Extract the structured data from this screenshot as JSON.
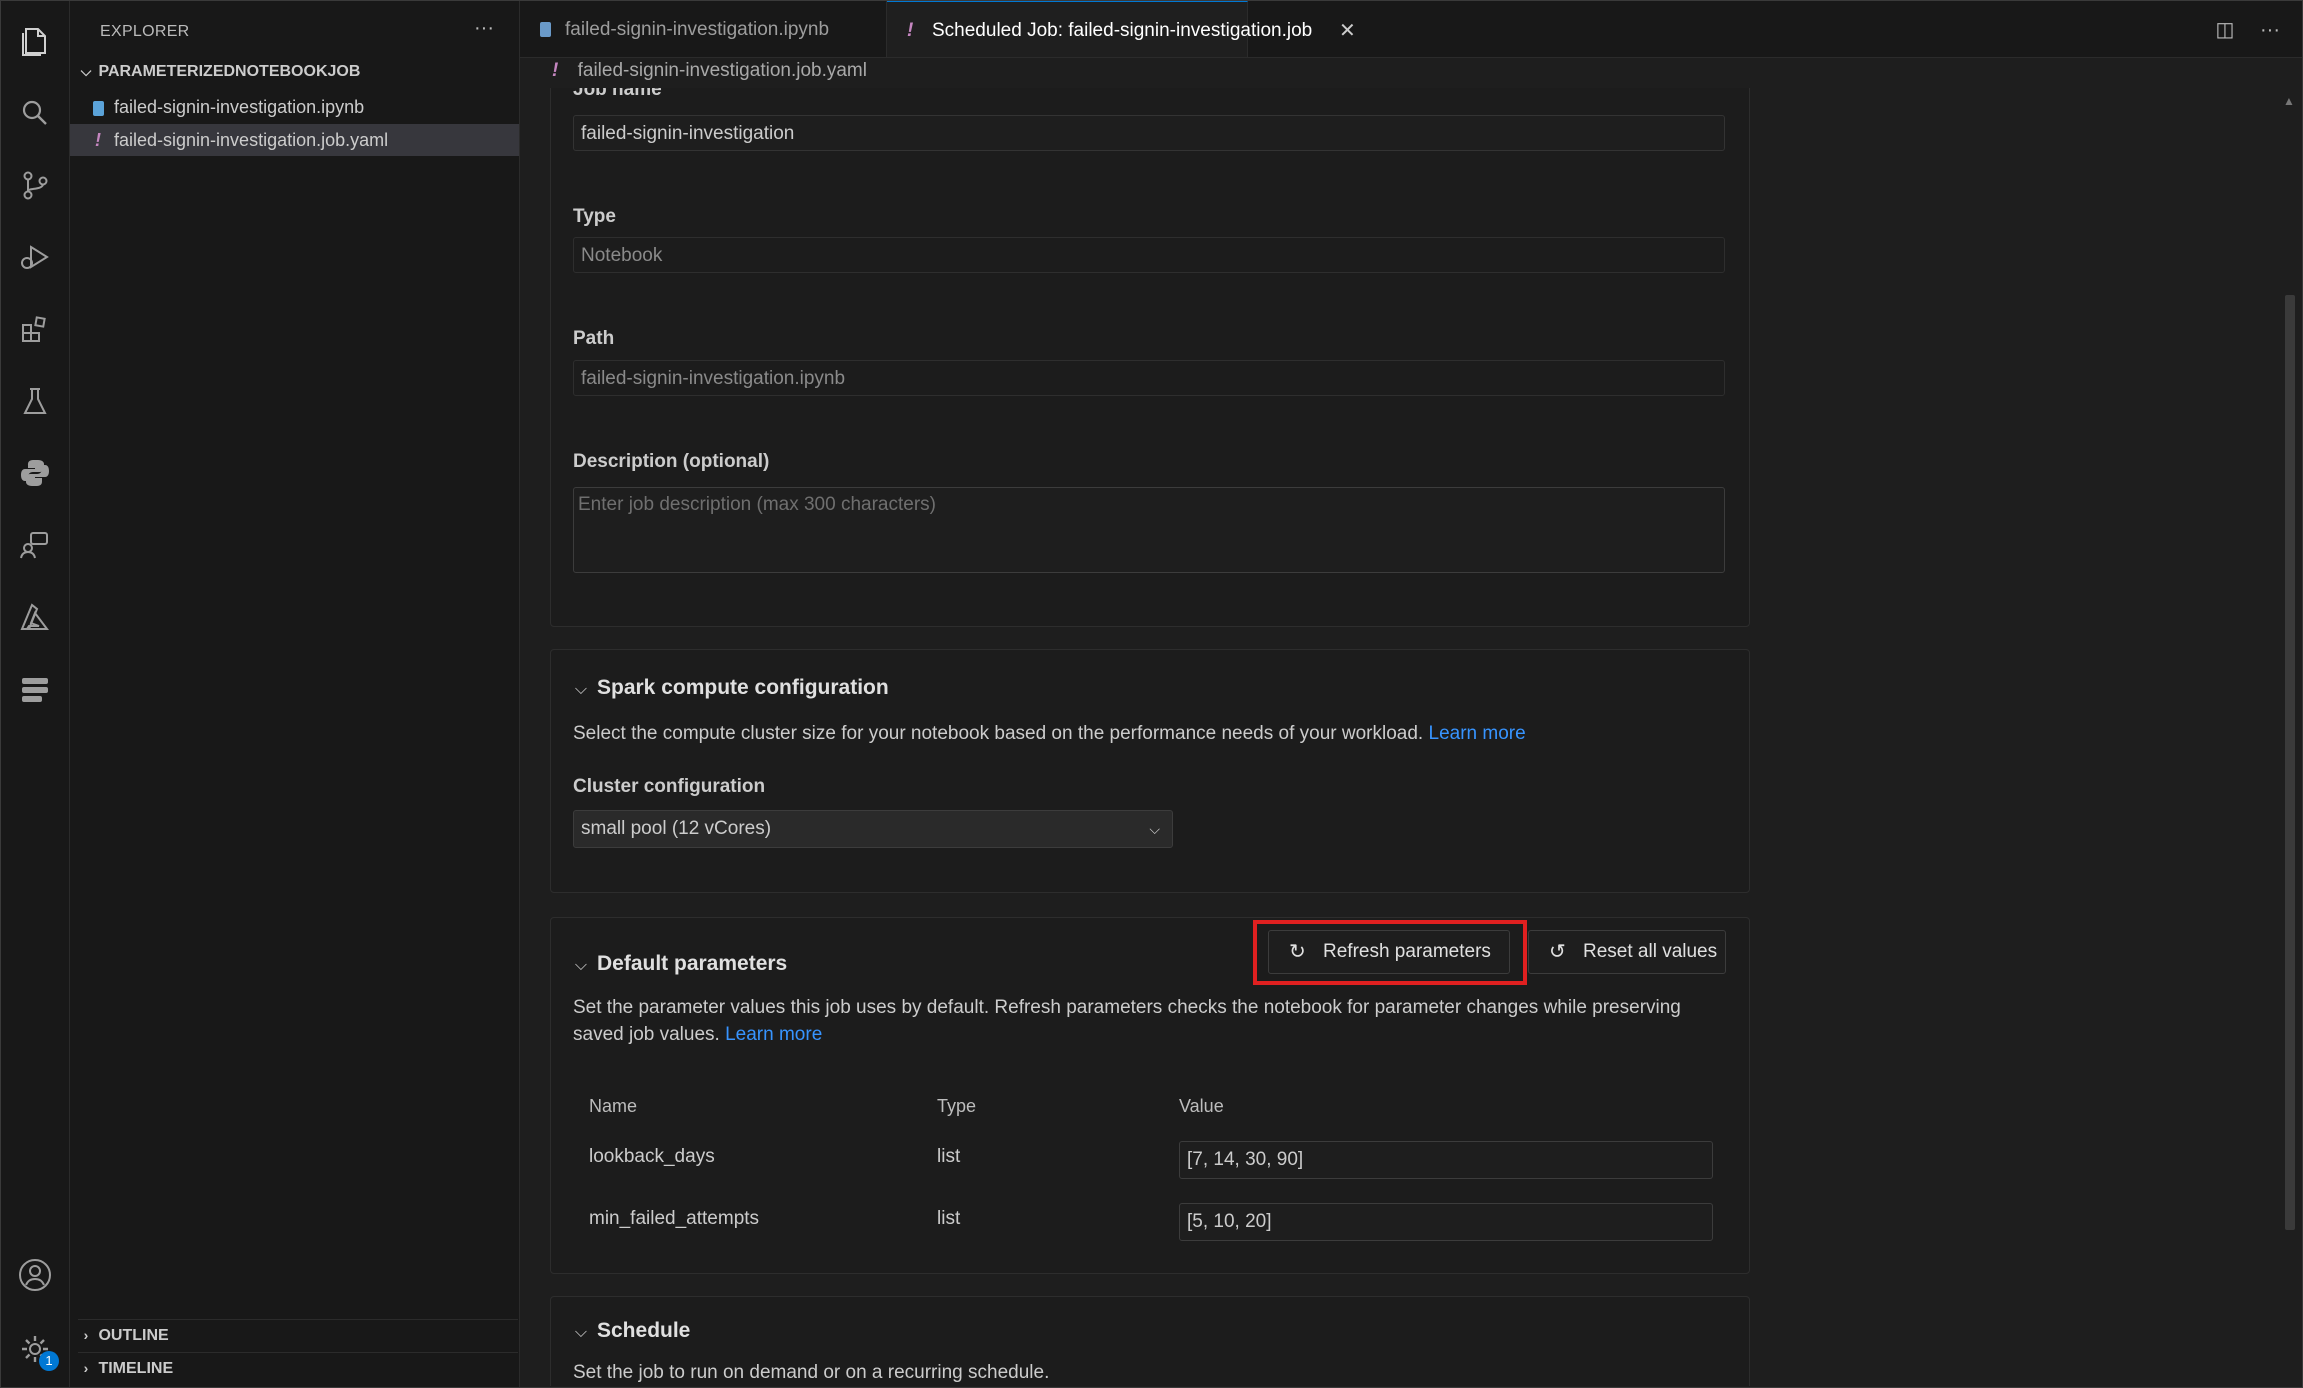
{
  "sidebar": {
    "title": "EXPLORER",
    "more_glyph": "···",
    "folder": "PARAMETERIZEDNOTEBOOKJOB",
    "files": [
      {
        "name": "failed-signin-investigation.ipynb",
        "icon": "notebook-file-icon"
      },
      {
        "name": "failed-signin-investigation.job.yaml",
        "icon": "yaml-file-icon",
        "glyph": "!"
      }
    ],
    "outline": "OUTLINE",
    "timeline": "TIMELINE"
  },
  "activity": {
    "settings_badge": "1",
    "icons": [
      "explorer-icon",
      "search-icon",
      "source-control-icon",
      "run-debug-icon",
      "extensions-icon",
      "testing-icon",
      "python-icon",
      "remote-chat-icon",
      "azure-icon",
      "data-icon",
      "account-icon",
      "settings-gear-icon"
    ]
  },
  "tabs": [
    {
      "label": "failed-signin-investigation.ipynb",
      "active": false
    },
    {
      "label": "Scheduled Job: failed-signin-investigation.job",
      "active": true,
      "glyph": "!",
      "close": "✕"
    }
  ],
  "breadcrumb": {
    "glyph": "!",
    "path": "failed-signin-investigation.job.yaml"
  },
  "form": {
    "job_name_label": "Job name",
    "job_name_value": "failed-signin-investigation",
    "type_label": "Type",
    "type_value": "Notebook",
    "path_label": "Path",
    "path_value": "failed-signin-investigation.ipynb",
    "description_label": "Description (optional)",
    "description_placeholder": "Enter job description (max 300 characters)"
  },
  "spark": {
    "title": "Spark compute configuration",
    "description": "Select the compute cluster size for your notebook based on the performance needs of your workload.",
    "learn_more": "Learn more",
    "cluster_label": "Cluster configuration",
    "cluster_value": "small pool (12 vCores)"
  },
  "params": {
    "title": "Default parameters",
    "refresh_label": "Refresh parameters",
    "reset_label": "Reset all values",
    "description": "Set the parameter values this job uses by default. Refresh parameters checks the notebook for parameter changes while preserving saved job values.",
    "learn_more": "Learn more",
    "columns": [
      "Name",
      "Type",
      "Value"
    ],
    "rows": [
      {
        "name": "lookback_days",
        "type": "list",
        "value": "[7, 14, 30, 90]"
      },
      {
        "name": "min_failed_attempts",
        "type": "list",
        "value": "[5, 10, 20]"
      }
    ]
  },
  "schedule": {
    "title": "Schedule",
    "description": "Set the job to run on demand or on a recurring schedule."
  },
  "colors": {
    "accent": "#0078d4",
    "link": "#3794ff",
    "highlight": "#e02020",
    "yaml_glyph": "#c586c0"
  }
}
